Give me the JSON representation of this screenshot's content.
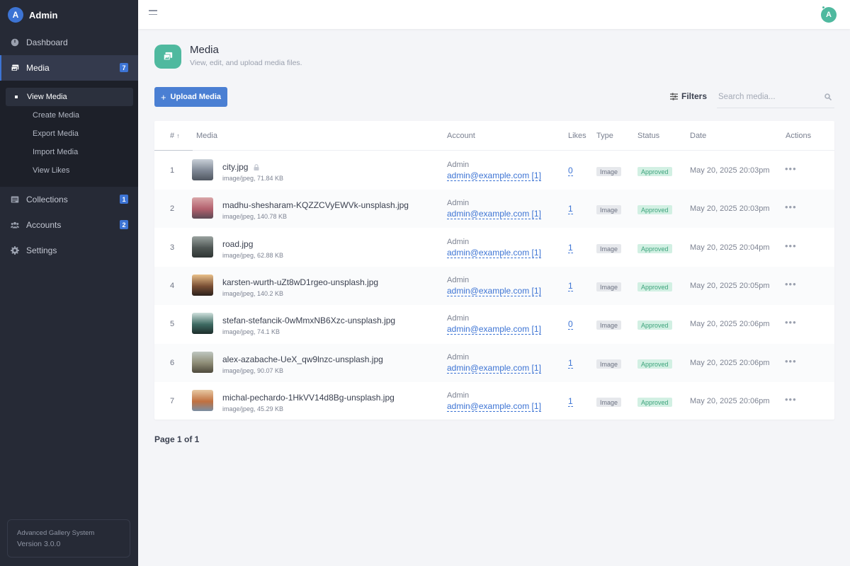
{
  "brand": {
    "avatar_letter": "A",
    "name": "Admin"
  },
  "sidebar": {
    "items": [
      {
        "label": "Dashboard",
        "icon": "dashboard-icon"
      },
      {
        "label": "Media",
        "icon": "media-icon",
        "badge": "7",
        "active": true
      },
      {
        "label": "Collections",
        "icon": "collections-icon",
        "badge": "1"
      },
      {
        "label": "Accounts",
        "icon": "accounts-icon",
        "badge": "2"
      },
      {
        "label": "Settings",
        "icon": "gear-icon"
      }
    ],
    "subitems": [
      {
        "label": "View Media",
        "active": true
      },
      {
        "label": "Create Media"
      },
      {
        "label": "Export Media"
      },
      {
        "label": "Import Media"
      },
      {
        "label": "View Likes"
      }
    ],
    "footer": {
      "title": "Advanced Gallery System",
      "version": "Version 3.0.0"
    }
  },
  "topbar": {
    "avatar_letter": "A"
  },
  "page": {
    "title": "Media",
    "subtitle": "View, edit, and upload media files.",
    "upload_label": "Upload Media",
    "filters_label": "Filters",
    "search_placeholder": "Search media..."
  },
  "table": {
    "headers": {
      "num": "#",
      "sort_glyph": "↑",
      "media": "Media",
      "account": "Account",
      "likes": "Likes",
      "type": "Type",
      "status": "Status",
      "date": "Date",
      "actions": "Actions"
    },
    "rows": [
      {
        "num": "1",
        "name": "city.jpg",
        "locked": true,
        "meta": "image/jpeg, 71.84 KB",
        "account": "Admin",
        "email": "admin@example.com [1]",
        "likes": "0",
        "type": "Image",
        "status": "Approved",
        "date": "May 20, 2025 20:03pm",
        "thumb_colors": [
          "#c9d0d8",
          "#7d8693",
          "#4f5660"
        ]
      },
      {
        "num": "2",
        "name": "madhu-shesharam-KQZZCVyEWVk-unsplash.jpg",
        "meta": "image/jpeg, 140.78 KB",
        "account": "Admin",
        "email": "admin@example.com [1]",
        "likes": "1",
        "type": "Image",
        "status": "Approved",
        "date": "May 20, 2025 20:03pm",
        "thumb_colors": [
          "#d9a6a8",
          "#b2606d",
          "#5c4a55"
        ]
      },
      {
        "num": "3",
        "name": "road.jpg",
        "meta": "image/jpeg, 62.88 KB",
        "account": "Admin",
        "email": "admin@example.com [1]",
        "likes": "1",
        "type": "Image",
        "status": "Approved",
        "date": "May 20, 2025 20:04pm",
        "thumb_colors": [
          "#9aa3a0",
          "#4e5653",
          "#2f3534"
        ]
      },
      {
        "num": "4",
        "name": "karsten-wurth-uZt8wD1rgeo-unsplash.jpg",
        "meta": "image/jpeg, 140.2 KB",
        "account": "Admin",
        "email": "admin@example.com [1]",
        "likes": "1",
        "type": "Image",
        "status": "Approved",
        "date": "May 20, 2025 20:05pm",
        "thumb_colors": [
          "#e9c08a",
          "#7a4f35",
          "#2b211c"
        ]
      },
      {
        "num": "5",
        "name": "stefan-stefancik-0wMmxNB6Xzc-unsplash.jpg",
        "meta": "image/jpeg, 74.1 KB",
        "account": "Admin",
        "email": "admin@example.com [1]",
        "likes": "0",
        "type": "Image",
        "status": "Approved",
        "date": "May 20, 2025 20:06pm",
        "thumb_colors": [
          "#cfe0dc",
          "#3d6a62",
          "#1d2d2b"
        ]
      },
      {
        "num": "6",
        "name": "alex-azabache-UeX_qw9lnzc-unsplash.jpg",
        "meta": "image/jpeg, 90.07 KB",
        "account": "Admin",
        "email": "admin@example.com [1]",
        "likes": "1",
        "type": "Image",
        "status": "Approved",
        "date": "May 20, 2025 20:06pm",
        "thumb_colors": [
          "#bfc7c1",
          "#8c8a74",
          "#4e4a3c"
        ]
      },
      {
        "num": "7",
        "name": "michal-pechardo-1HkVV14d8Bg-unsplash.jpg",
        "meta": "image/jpeg, 45.29 KB",
        "account": "Admin",
        "email": "admin@example.com [1]",
        "likes": "1",
        "type": "Image",
        "status": "Approved",
        "date": "May 20, 2025 20:06pm",
        "thumb_colors": [
          "#e7c9a3",
          "#c0703f",
          "#7a8ea3"
        ]
      }
    ]
  },
  "pager": {
    "label": "Page 1 of 1"
  },
  "colors": {
    "sidebar_bg": "#262a36",
    "accent_blue": "#3d74d4",
    "accent_green": "#4fb99f",
    "approved_bg": "#d2f0e3",
    "approved_text": "#3fa47d"
  }
}
